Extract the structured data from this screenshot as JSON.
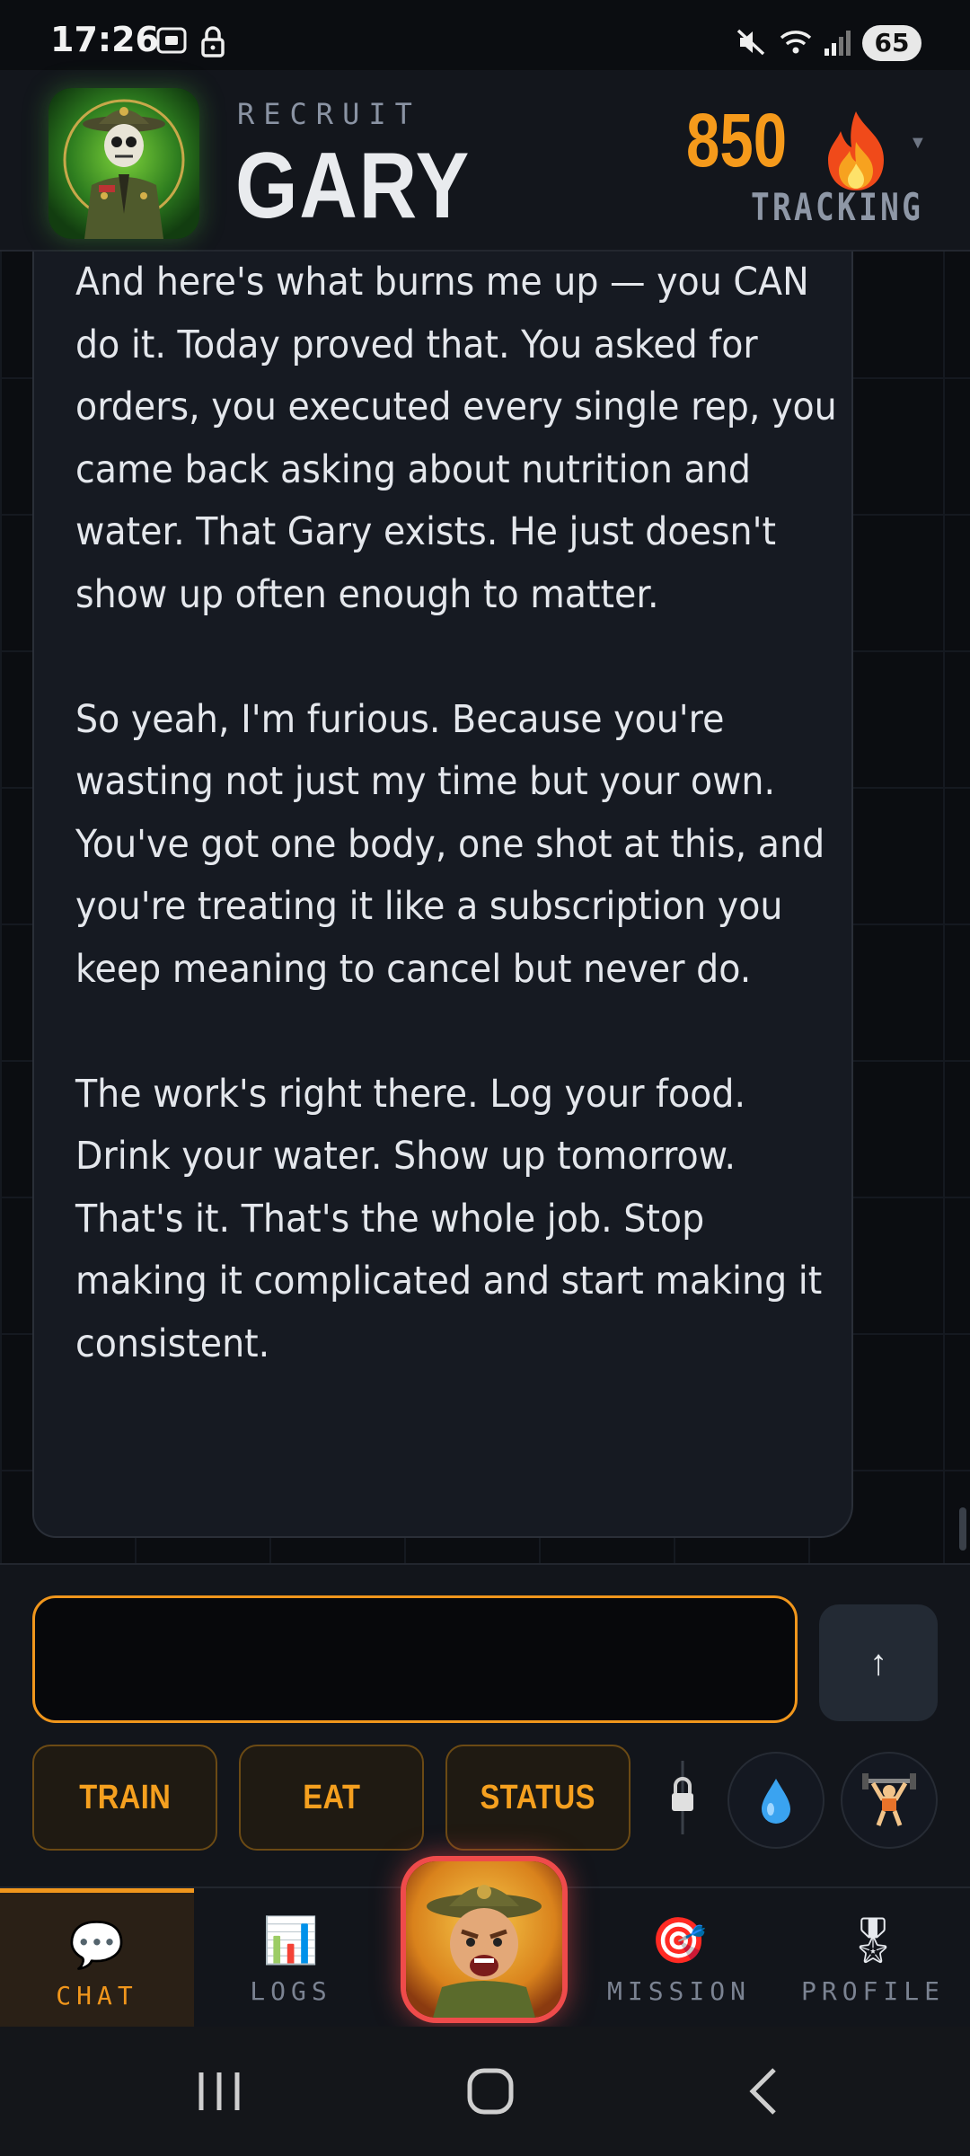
{
  "status_bar": {
    "time": "17:26",
    "battery": "65",
    "icons": [
      "screenshot-icon",
      "lock-icon",
      "mute-icon",
      "wifi-icon",
      "signal-icon"
    ]
  },
  "header": {
    "rank": "RECRUIT",
    "name": "GARY",
    "score": "850",
    "score_icon": "flame-icon",
    "tracking": "TRACKING"
  },
  "chat": {
    "message": "And here's what burns me up — you CAN do it. Today proved that. You asked for orders, you executed every single rep, you came back asking about nutrition and water. That Gary exists. He just doesn't show up often enough to matter.\n\nSo yeah, I'm furious. Because you're wasting not just my time but your own. You've got one body, one shot at this, and you're treating it like a subscription you keep meaning to cancel but never do.\n\nThe work's right there. Log your food. Drink your water. Show up tomorrow. That's it. That's the whole job. Stop making it complicated and start making it consistent."
  },
  "composer": {
    "input_value": "",
    "send_label": "↑",
    "quick_actions": [
      "TRAIN",
      "EAT",
      "STATUS"
    ],
    "water_icon": "💧",
    "workout_icon": "🏋"
  },
  "nav": {
    "items": [
      {
        "label": "CHAT",
        "icon": "💬"
      },
      {
        "label": "LOGS",
        "icon": "📊"
      },
      {
        "label": "MISSION",
        "icon": "🎯"
      },
      {
        "label": "PROFILE",
        "icon": "🎖"
      }
    ]
  },
  "colors": {
    "accent": "#f0961c",
    "background": "#0b0d11",
    "bubble": "#161a22",
    "center_ring": "#ef4b4b"
  }
}
